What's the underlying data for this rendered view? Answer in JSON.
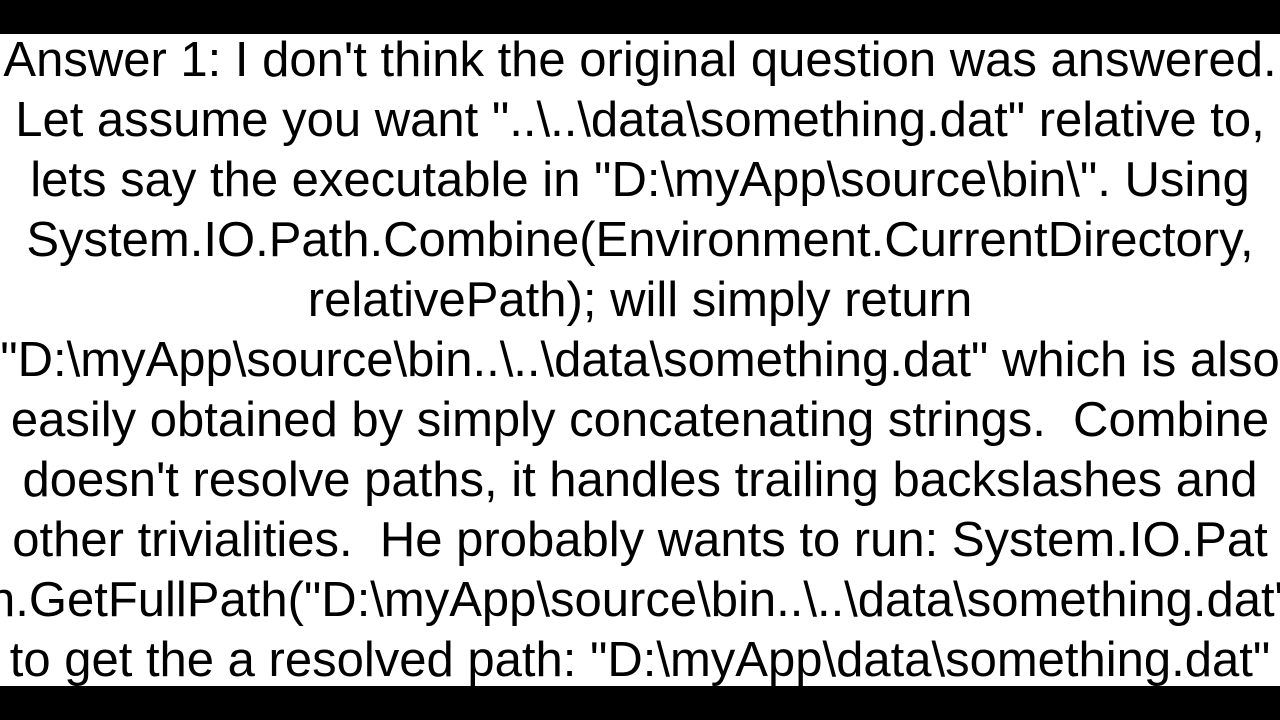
{
  "answer": {
    "label": "Answer 1:",
    "line1": "Answer 1: I don't think the original question was answered.",
    "line2": "Let assume you want \"..\\..\\data\\something.dat\" relative to,",
    "line3": "lets say the executable in \"D:\\myApp\\source\\bin\\\". Using",
    "line4": "System.IO.Path.Combine(Environment.CurrentDirectory,",
    "line5": "relativePath); will simply return",
    "line6": "\"D:\\myApp\\source\\bin..\\..\\data\\something.dat\" which is also",
    "line7": "easily obtained by simply concatenating strings.  Combine",
    "line8": "doesn't resolve paths, it handles trailing backslashes and",
    "line9": "other trivialities.  He probably wants to run: System.IO.Pat",
    "line10": "h.GetFullPath(\"D:\\myApp\\source\\bin..\\..\\data\\something.dat\"",
    "line11": "to get the a resolved path: \"D:\\myApp\\data\\something.dat\""
  }
}
